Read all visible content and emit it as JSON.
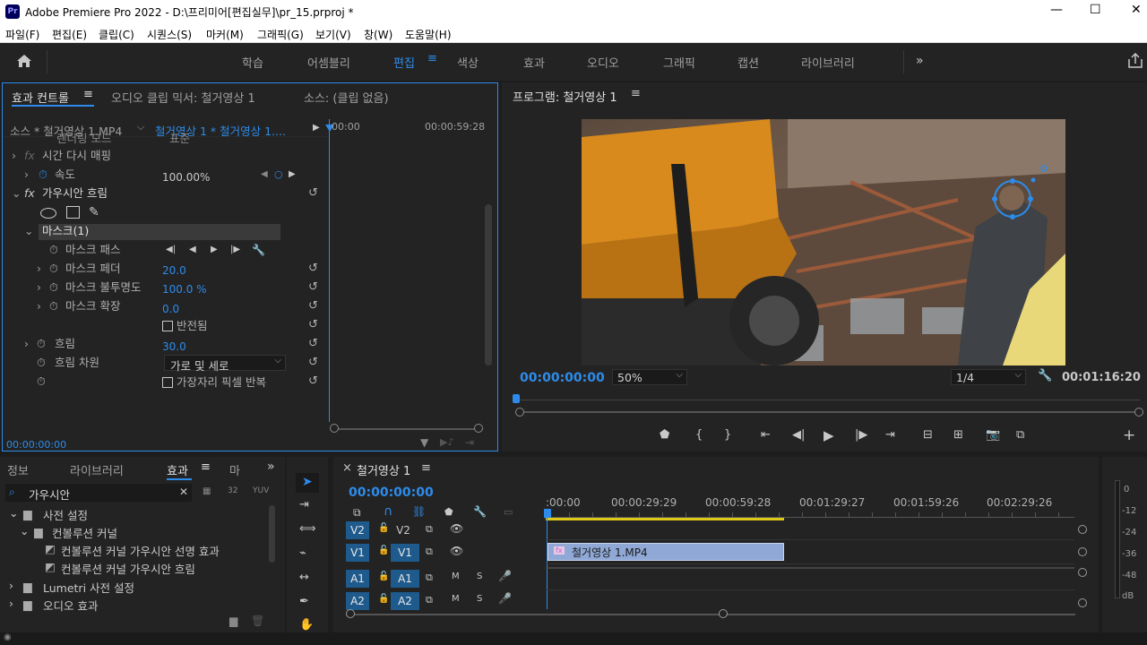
{
  "titlebar": {
    "app_icon": "Pr",
    "title": "Adobe Premiere Pro 2022 - D:\\프리미어[편집실무]\\pr_15.prproj *",
    "minimize": "—",
    "maximize": "☐",
    "close": "✕"
  },
  "menu": [
    "파일(F)",
    "편집(E)",
    "클립(C)",
    "시퀀스(S)",
    "마커(M)",
    "그래픽(G)",
    "보기(V)",
    "창(W)",
    "도움말(H)"
  ],
  "workspaces": [
    "학습",
    "어셈블리",
    "편집",
    "색상",
    "효과",
    "오디오",
    "그래픽",
    "캡션",
    "라이브러리"
  ],
  "workspace_active": "편집",
  "effect_controls": {
    "tabs": [
      "효과 컨트롤",
      "오디오 클립 믹서: 철거영상 1",
      "소스: (클립 없음)"
    ],
    "source_label": "소스 * 철거영상 1.MP4",
    "sequence_label": "철거영상 1 * 철거영상 1....",
    "ruler_start": "00:00",
    "ruler_end": "00:00:59:28",
    "hidden_row": "렌더링 모드",
    "hidden_value": "표준",
    "time_remap": "시간 다시 매핑",
    "speed_label": "속도",
    "speed_value": "100.00%",
    "blur_effect": "가우시안 흐림",
    "mask_name": "마스크(1)",
    "mask_path": "마스크 패스",
    "mask_feather": "마스크 페더",
    "mask_feather_value": "20.0",
    "mask_opacity": "마스크 불투명도",
    "mask_opacity_value": "100.0 %",
    "mask_expand": "마스크 확장",
    "mask_expand_value": "0.0",
    "inverted": "반전됨",
    "blurriness": "흐림",
    "blurriness_value": "30.0",
    "blur_dim": "흐림 차원",
    "blur_dim_value": "가로 및 세로",
    "repeat_edge": "가장자리 픽셀 반복",
    "timecode": "00:00:00:00"
  },
  "program": {
    "title": "프로그램: 철거영상 1",
    "timecode": "00:00:00:00",
    "zoom": "50%",
    "quality": "1/4",
    "duration": "00:01:16:20"
  },
  "effects_panel": {
    "tabs": [
      "정보",
      "라이브러리",
      "효과",
      "마"
    ],
    "search_value": "가우시안",
    "tree": [
      "사전 설정",
      "컨볼루션 커널",
      "컨볼루션 커널 가우시안 선명 효과",
      "컨볼루션 커널 가우시안 흐림",
      "Lumetri 사전 설정",
      "오디오 효과"
    ]
  },
  "timeline": {
    "title": "철거영상 1",
    "timecode": "00:00:00:00",
    "ruler": [
      ":00:00",
      "00:00:29:29",
      "00:00:59:28",
      "00:01:29:27",
      "00:01:59:26",
      "00:02:29:26"
    ],
    "tracks": [
      {
        "src": "V2",
        "dst": "V2"
      },
      {
        "src": "V1",
        "dst": "V1"
      },
      {
        "src": "A1",
        "dst": "A1"
      },
      {
        "src": "A2",
        "dst": "A2"
      }
    ],
    "clip_label": "철거영상 1.MP4",
    "clip_fx": "fx",
    "mute": "M",
    "solo": "S"
  },
  "meter": {
    "labels": [
      "0",
      "-12",
      "-24",
      "-36",
      "-48",
      "dB"
    ]
  }
}
